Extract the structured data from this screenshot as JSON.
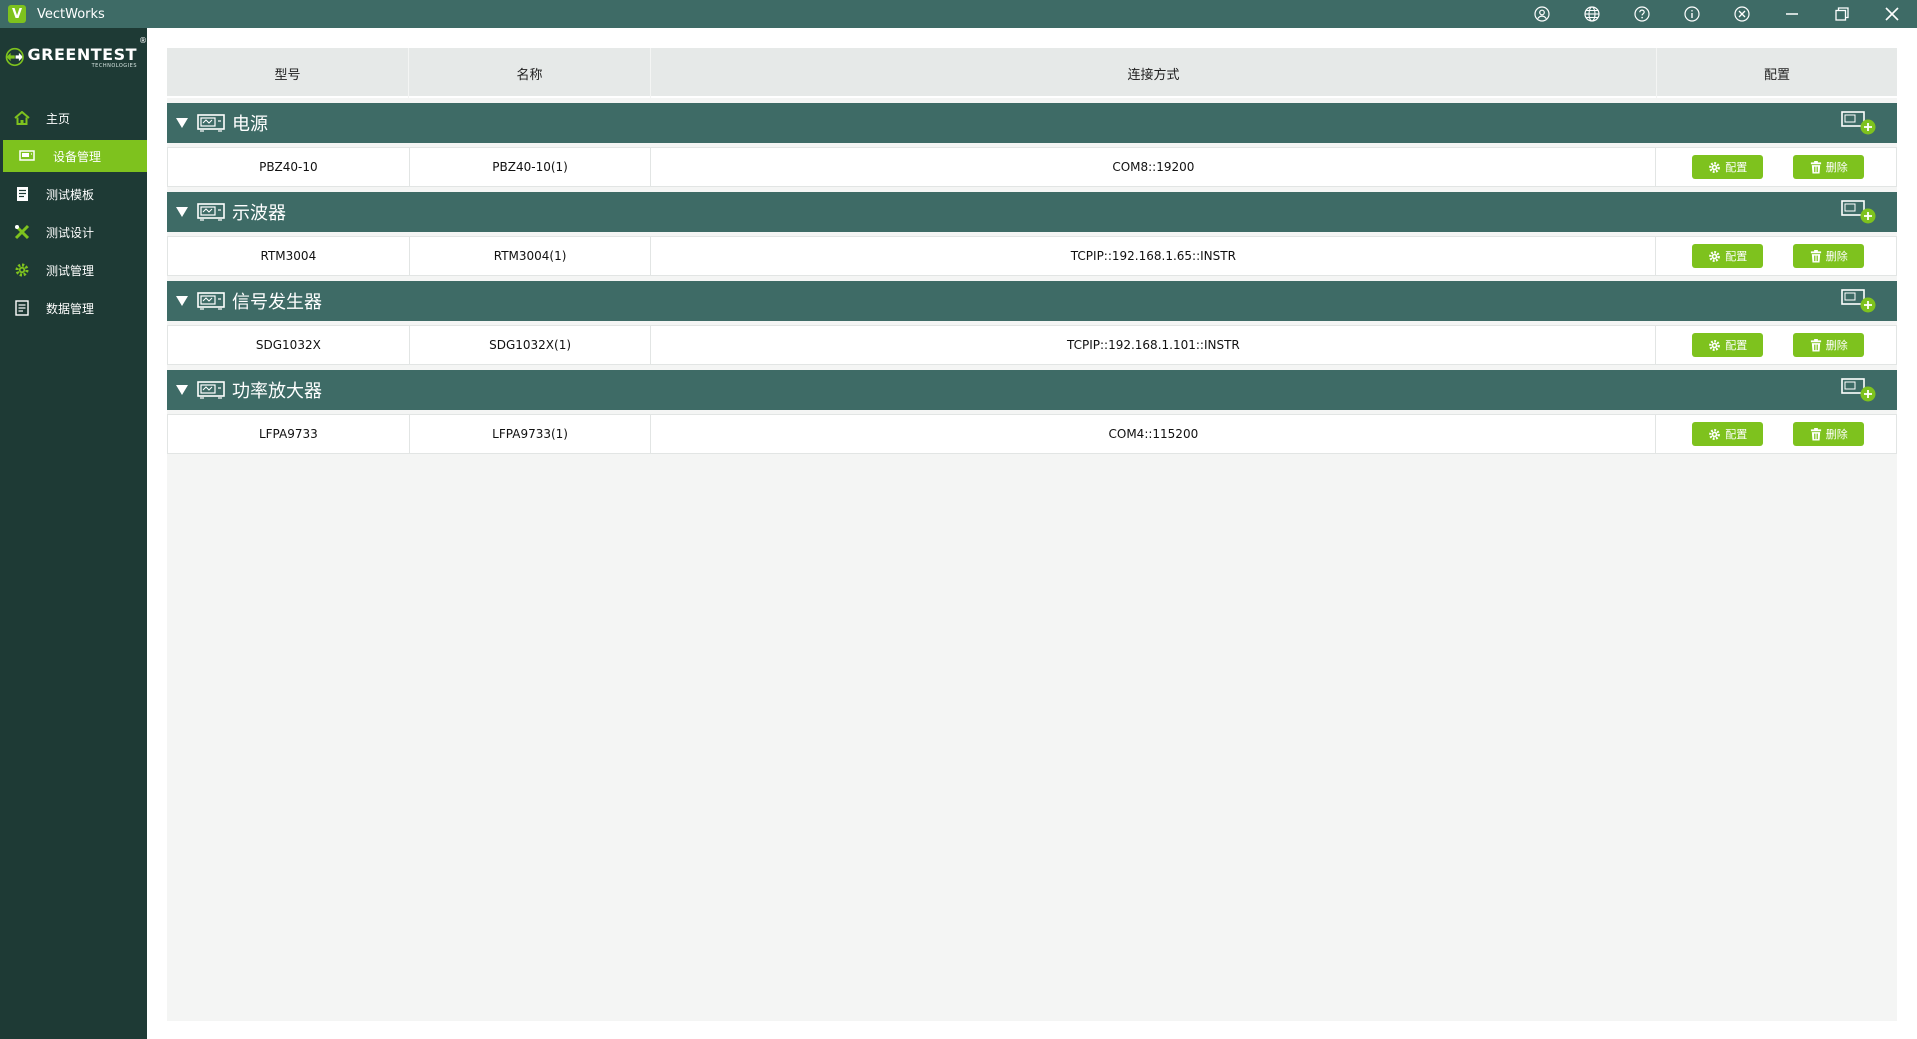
{
  "app": {
    "logo_letter": "V",
    "title": "VectWorks"
  },
  "title_icons": [
    "user-icon",
    "globe-icon",
    "help-icon",
    "info-icon",
    "tools-icon",
    "minimize-icon",
    "restore-icon",
    "close-icon"
  ],
  "brand": {
    "name": "GREENTEST",
    "sub": "TECHNOLOGIES",
    "reg": "®"
  },
  "sidebar": {
    "items": [
      {
        "label": "主页",
        "icon": "home-icon",
        "active": false
      },
      {
        "label": "设备管理",
        "icon": "device-icon",
        "active": true
      },
      {
        "label": "测试模板",
        "icon": "template-icon",
        "active": false
      },
      {
        "label": "测试设计",
        "icon": "design-icon",
        "active": false
      },
      {
        "label": "测试管理",
        "icon": "gear-icon",
        "active": false
      },
      {
        "label": "数据管理",
        "icon": "data-icon",
        "active": false
      }
    ]
  },
  "table": {
    "headers": [
      "型号",
      "名称",
      "连接方式",
      "配置"
    ],
    "config_label": "配置",
    "delete_label": "删除",
    "groups": [
      {
        "title": "电源",
        "rows": [
          {
            "model": "PBZ40-10",
            "name": "PBZ40-10(1)",
            "connection": "COM8::19200"
          }
        ]
      },
      {
        "title": "示波器",
        "rows": [
          {
            "model": "RTM3004",
            "name": "RTM3004(1)",
            "connection": "TCPIP::192.168.1.65::INSTR"
          }
        ]
      },
      {
        "title": "信号发生器",
        "rows": [
          {
            "model": "SDG1032X",
            "name": "SDG1032X(1)",
            "connection": "TCPIP::192.168.1.101::INSTR"
          }
        ]
      },
      {
        "title": "功率放大器",
        "rows": [
          {
            "model": "LFPA9733",
            "name": "LFPA9733(1)",
            "connection": "COM4::115200"
          }
        ]
      }
    ]
  },
  "colors": {
    "titlebar": "#3e6b66",
    "sidebar": "#1e3a35",
    "accent": "#7ec21e",
    "group_header": "#3e6b66"
  }
}
